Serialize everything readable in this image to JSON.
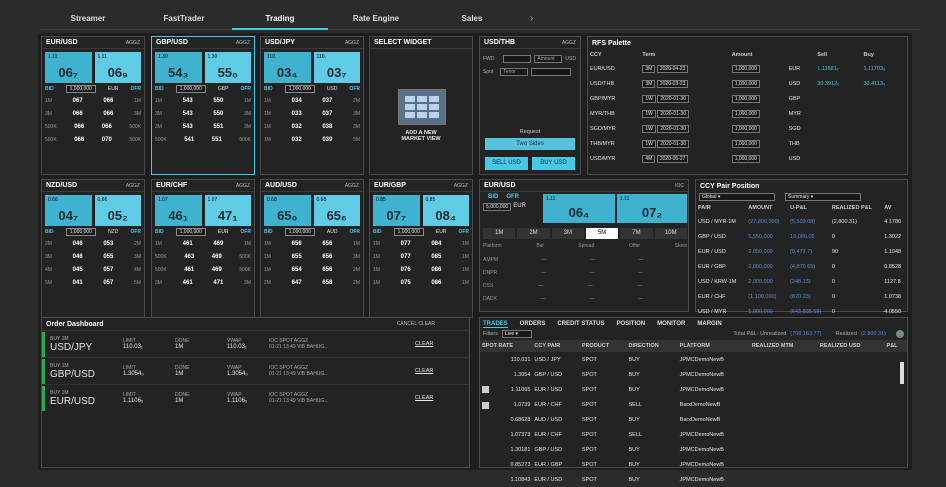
{
  "nav": {
    "tabs": [
      "Streamer",
      "FastTrader",
      "Trading",
      "Rate Engine",
      "Sales"
    ],
    "active": 2,
    "next": "›"
  },
  "tiles": [
    {
      "pair": "EUR/USD",
      "type": "AGGZ",
      "bid_sm": "1.11",
      "ofr_sm": "1.11",
      "bid": "06₇",
      "ofr": "06₉",
      "amount": "1,000,000",
      "ccy": "EUR",
      "ladder": [
        [
          "1M",
          "067",
          "066",
          "1M"
        ],
        [
          "3M",
          "066",
          "066",
          "3M"
        ],
        [
          "500K",
          "066",
          "066",
          "500K"
        ],
        [
          "500K",
          "066",
          "070",
          "500K"
        ]
      ]
    },
    {
      "pair": "GBP/USD",
      "type": "AGGZ",
      "bid_sm": "1.30",
      "ofr_sm": "1.30",
      "bid": "54₃",
      "ofr": "55₀",
      "amount": "1,000,000",
      "ccy": "GBP",
      "ladder": [
        [
          "1M",
          "543",
          "550",
          "1M"
        ],
        [
          "3M",
          "543",
          "550",
          "3M"
        ],
        [
          "3M",
          "543",
          "551",
          "3M"
        ],
        [
          "500K",
          "541",
          "551",
          "500K"
        ]
      ]
    },
    {
      "pair": "USD/JPY",
      "type": "AGGZ",
      "bid_sm": "110.",
      "ofr_sm": "110.",
      "bid": "03₄",
      "ofr": "03₇",
      "amount": "1,000,000",
      "ccy": "USD",
      "ladder": [
        [
          "1M",
          "034",
          "037",
          "2M"
        ],
        [
          "1M",
          "033",
          "037",
          "3M"
        ],
        [
          "1M",
          "032",
          "038",
          "3M"
        ],
        [
          "1M",
          "032",
          "039",
          "5M"
        ]
      ]
    },
    {
      "pair": "NZD/USD",
      "type": "AGGZ",
      "bid_sm": "0.66",
      "ofr_sm": "0.66",
      "bid": "04₇",
      "ofr": "05₂",
      "amount": "1,000,000",
      "ccy": "NZD",
      "ladder": [
        [
          "2M",
          "046",
          "053",
          "2M"
        ],
        [
          "3M",
          "046",
          "055",
          "3M"
        ],
        [
          "4M",
          "045",
          "057",
          "4M"
        ],
        [
          "5M",
          "041",
          "057",
          "5M"
        ]
      ]
    },
    {
      "pair": "EUR/CHF",
      "type": "AGGZ",
      "bid_sm": "1.07",
      "ofr_sm": "1.07",
      "bid": "46₁",
      "ofr": "47₁",
      "amount": "1,000,000",
      "ccy": "EUR",
      "ladder": [
        [
          "1M",
          "461",
          "469",
          "1M"
        ],
        [
          "500K",
          "463",
          "469",
          "500K"
        ],
        [
          "500K",
          "461",
          "469",
          "500K"
        ],
        [
          "3M",
          "461",
          "471",
          "3M"
        ]
      ]
    },
    {
      "pair": "AUD/USD",
      "type": "AGGZ",
      "bid_sm": "0.68",
      "ofr_sm": "0.68",
      "bid": "65₀",
      "ofr": "65₆",
      "amount": "1,000,000",
      "ccy": "AUD",
      "ladder": [
        [
          "1M",
          "656",
          "656",
          "1M"
        ],
        [
          "1M",
          "655",
          "656",
          "3M"
        ],
        [
          "1M",
          "654",
          "656",
          "2M"
        ],
        [
          "2M",
          "647",
          "658",
          "2M"
        ]
      ]
    },
    {
      "pair": "EUR/GBP",
      "type": "AGGZ",
      "bid_sm": "0.85",
      "ofr_sm": "0.85",
      "bid": "07₇",
      "ofr": "08₄",
      "amount": "1,000,000",
      "ccy": "EUR",
      "ladder": [
        [
          "1M",
          "077",
          "084",
          "1M"
        ],
        [
          "1M",
          "077",
          "085",
          "1M"
        ],
        [
          "1M",
          "076",
          "086",
          "1M"
        ],
        [
          "1M",
          "075",
          "086",
          "1M"
        ]
      ]
    }
  ],
  "select_widget": {
    "title": "SELECT WIDGET",
    "label": "ADD A NEW MARKET VIEW"
  },
  "usdthb": {
    "pair": "USD/THB",
    "type": "AGGZ",
    "fwd": "FWD",
    "spot": "Spot",
    "amount": "Amount",
    "ccy": "USD",
    "tenor": "Tenor",
    "request": "Request",
    "two_sides": "Two Sides",
    "sell": "SELL USD",
    "buy": "BUY USD"
  },
  "rfs": {
    "title": "RFS Palette",
    "headers": [
      "CCY",
      "Term",
      "Amount",
      "",
      "Sell",
      "Buy"
    ],
    "rows": [
      [
        "EUR/USD",
        "3M",
        "2020-04-23",
        "1,000,000",
        "EUR",
        "1.11681₇",
        "1.11703₈"
      ],
      [
        "USD/THB",
        "3M",
        "2020-03-23",
        "1,000,000",
        "USD",
        "30.3912₀",
        "30.4113₀"
      ],
      [
        "GBP/MYR",
        "1W",
        "2020-01-30",
        "1,000,000",
        "GBP",
        "",
        ""
      ],
      [
        "MYR/THB",
        "1W",
        "2020-01-30",
        "1,000,000",
        "MYR",
        "",
        ""
      ],
      [
        "SGD/MYR",
        "1W",
        "2020-01-30",
        "1,000,000",
        "SGD",
        "",
        ""
      ],
      [
        "THB/MYR",
        "1W",
        "2020-01-30",
        "1,000,000",
        "THB",
        "",
        ""
      ],
      [
        "USD/MYR",
        "4M",
        "2020-05-27",
        "1,000,000",
        "USD",
        "",
        ""
      ]
    ]
  },
  "big_eurusd": {
    "pair": "EUR/USD",
    "type": "IOC",
    "bid": "BID",
    "ofr": "OFR",
    "bid_sm": "1.11",
    "ofr_sm": "1.11",
    "bid_big": "06₄",
    "ofr_big": "07₂",
    "amount": "5,000,000",
    "ccy": "EUR",
    "tenors": [
      "1M",
      "2M",
      "3M",
      "5M",
      "7M",
      "10M"
    ],
    "active_tenor": 3,
    "cols": [
      "Platform",
      "Bid",
      "Spread",
      "Offer",
      "Skew"
    ],
    "rows": [
      "AMPM",
      "DNPR",
      "DSS",
      "DADX"
    ]
  },
  "ccy": {
    "title": "CCY Pair Position",
    "filter1": "Global",
    "filter2": "Summary",
    "headers": [
      "PAIR",
      "AMOUNT",
      "U-P&L",
      "REALIZED P&L",
      "AV"
    ],
    "rows": [
      [
        "USD / MYR-1M",
        "(27,800,000)",
        "(5,503.08)",
        "(2,800.31)",
        "4.1780"
      ],
      [
        "GBP / USD",
        "5,550,000",
        "19,080.05",
        "0",
        "1.3022"
      ],
      [
        "EUR / USD",
        "2,050,000",
        "(9,472.7)",
        "90",
        "1.1048"
      ],
      [
        "EUR / GBP",
        "2,000,000",
        "(4,870.65)",
        "0",
        "0.8528"
      ],
      [
        "USD / KRW-1M",
        "2,000,000",
        "(248.13)",
        "0",
        "1127.8"
      ],
      [
        "EUR / CHF",
        "(1,100,000)",
        "(870.23)",
        "0",
        "1.0738"
      ],
      [
        "USD / MYR",
        "1,000,000",
        "(643,835.59)",
        "0",
        "4.0550"
      ]
    ]
  },
  "orders": {
    "title": "Order Dashboard",
    "cancel": "CANCEL",
    "clear": "CLEAR",
    "items": [
      {
        "side": "BUY",
        "qty": "1M",
        "pair": "USD/JPY",
        "limit_l": "LIMIT",
        "limit": "110.03₁",
        "done_l": "DONE",
        "done": "1M",
        "vwap_l": "VWAP",
        "vwap": "110.03₁",
        "ioc": "IOC",
        "spot": "SPOT",
        "aggz": "AGGZ",
        "info": "01-21 13:49 VIB BAHUG..."
      },
      {
        "side": "BUY",
        "qty": "1M",
        "pair": "GBP/USD",
        "limit_l": "LIMIT",
        "limit": "1.3054₀",
        "done_l": "DONE",
        "done": "1M",
        "vwap_l": "VWAP",
        "vwap": "1.3054₀",
        "ioc": "IOC",
        "spot": "SPOT",
        "aggz": "AGGZ",
        "info": "01-21 13:49 VIB BAHUG..."
      },
      {
        "side": "BUY",
        "qty": "1M",
        "pair": "EUR/USD",
        "limit_l": "LIMIT",
        "limit": "1.1106₅",
        "done_l": "DONE",
        "done": "1M",
        "vwap_l": "VWAP",
        "vwap": "1.1106₅",
        "ioc": "IOC",
        "spot": "SPOT",
        "aggz": "AGGZ",
        "info": "01-21 13:49 VIB BAHUG..."
      }
    ]
  },
  "trades": {
    "tabs": [
      "TRADES",
      "ORDERS",
      "CREDIT STATUS",
      "POSITION",
      "MONITOR",
      "MARGIN"
    ],
    "filter_label": "Filters",
    "filter_value": "Live",
    "total_label": "Total P&L: Unrealized",
    "unrealized": "(708,163.77)",
    "realized_label": "Realized",
    "realized": "(2,800.31)",
    "headers": [
      "SPOT RATE",
      "CCY PAIR",
      "PRODUCT",
      "DIRECTION",
      "PLATFORM",
      "REALIZED MTM",
      "REALIZED USD",
      "P&L"
    ],
    "rows": [
      [
        "110.031",
        "USD / JPY",
        "SPOT",
        "BUY",
        "JPMCDemoNewB"
      ],
      [
        "1.3054",
        "GBP / USD",
        "SPOT",
        "BUY",
        "JPMCDemoNewB"
      ],
      [
        "1.11065",
        "EUR / USD",
        "SPOT",
        "BUY",
        "JPMCDemoNewB"
      ],
      [
        "1.0739",
        "EUR / CHF",
        "SPOT",
        "SELL",
        "BarxDemoNewB"
      ],
      [
        "0.68628",
        "AUD / USD",
        "SPOT",
        "BUY",
        "BarxDemoNewB"
      ],
      [
        "1.07373",
        "EUR / CHF",
        "SPOT",
        "SELL",
        "JPMCDemoNewB"
      ],
      [
        "1.30181",
        "GBP / USD",
        "SPOT",
        "BUY",
        "JPMCDemoNewB"
      ],
      [
        "0.85273",
        "EUR / GBP",
        "SPOT",
        "BUY",
        "JPMCDemoNewB"
      ],
      [
        "1.10843",
        "EUR / USD",
        "SPOT",
        "BUY",
        "JPMCDemoNewB"
      ]
    ]
  }
}
